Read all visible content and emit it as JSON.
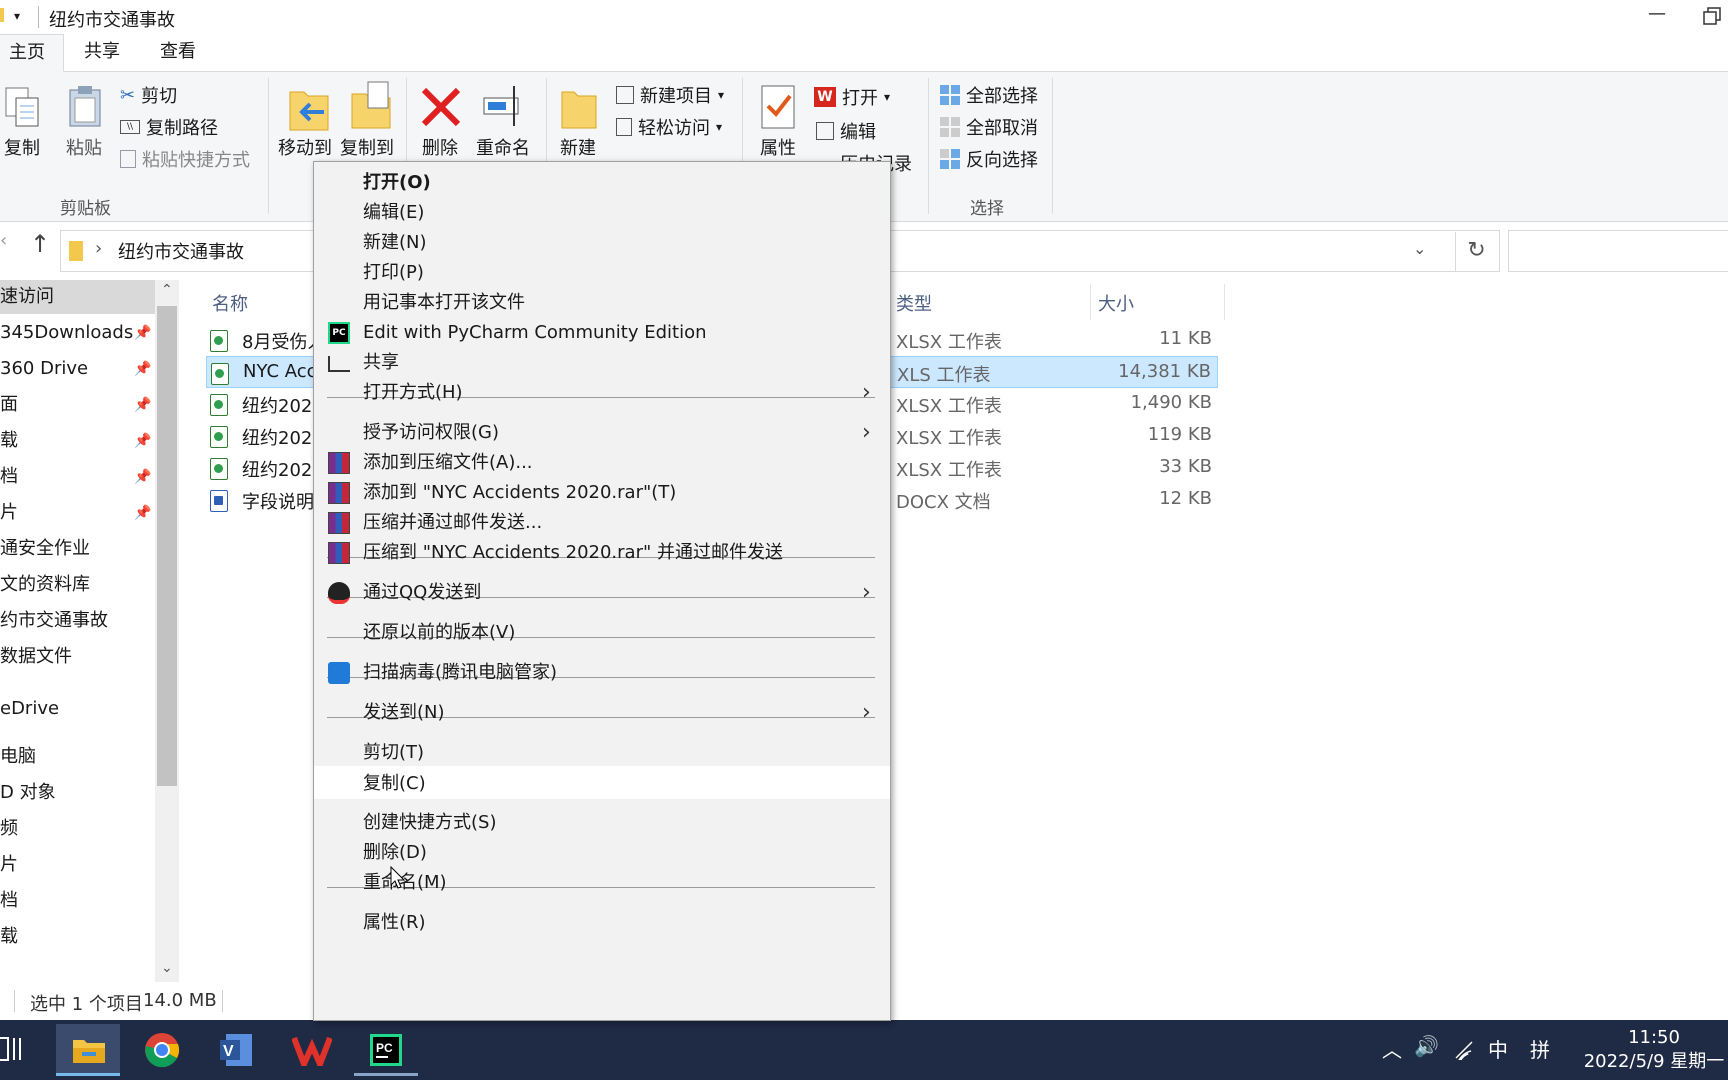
{
  "window": {
    "title": "纽约市交通事故"
  },
  "ribbon_tabs": [
    "主页",
    "共享",
    "查看"
  ],
  "ribbon": {
    "copy": "复制",
    "paste": "粘贴",
    "cut": "剪切",
    "copy_path": "复制路径",
    "paste_shortcut": "粘贴快捷方式",
    "clipboard_group": "剪贴板",
    "move_to": "移动到",
    "copy_to": "复制到",
    "delete": "删除",
    "rename": "重命名",
    "new_folder": "新建",
    "new_item": "新建项目",
    "easy_access": "轻松访问",
    "properties": "属性",
    "open": "打开",
    "edit": "编辑",
    "history_partial": "历史记录",
    "select_all": "全部选择",
    "select_none": "全部取消",
    "invert_selection": "反向选择",
    "select_group": "选择"
  },
  "address": {
    "path": "纽约市交通事故"
  },
  "nav": {
    "items": [
      {
        "label": "速访问",
        "pinned": false,
        "selected": true
      },
      {
        "label": "345Downloads",
        "pinned": true
      },
      {
        "label": "360 Drive",
        "pinned": true
      },
      {
        "label": "面",
        "pinned": true
      },
      {
        "label": "载",
        "pinned": true
      },
      {
        "label": "档",
        "pinned": true
      },
      {
        "label": "片",
        "pinned": true
      },
      {
        "label": "通安全作业",
        "pinned": false
      },
      {
        "label": "文的资料库",
        "pinned": false
      },
      {
        "label": "约市交通事故",
        "pinned": false
      },
      {
        "label": "数据文件",
        "pinned": false
      },
      {
        "label": "eDrive",
        "pinned": false
      },
      {
        "label": "电脑",
        "pinned": false
      },
      {
        "label": "D 对象",
        "pinned": false
      },
      {
        "label": "频",
        "pinned": false
      },
      {
        "label": "片",
        "pinned": false
      },
      {
        "label": "档",
        "pinned": false
      },
      {
        "label": "载",
        "pinned": false
      }
    ]
  },
  "columns": {
    "name": "名称",
    "type": "类型",
    "size": "大小"
  },
  "files": [
    {
      "name": "8月受伤人",
      "type": "XLSX 工作表",
      "size": "11 KB",
      "icon": "excel-icon",
      "selected": false
    },
    {
      "name": "NYC Acc",
      "type": "XLS 工作表",
      "size": "14,381 KB",
      "icon": "excel-icon",
      "selected": true
    },
    {
      "name": "纽约202",
      "type": "XLSX 工作表",
      "size": "1,490 KB",
      "icon": "excel-icon",
      "selected": false
    },
    {
      "name": "纽约202",
      "type": "XLSX 工作表",
      "size": "119 KB",
      "icon": "excel-icon",
      "selected": false
    },
    {
      "name": "纽约202",
      "type": "XLSX 工作表",
      "size": "33 KB",
      "icon": "excel-icon",
      "selected": false
    },
    {
      "name": "字段说明",
      "type": "DOCX 文档",
      "size": "12 KB",
      "icon": "word-icon",
      "selected": false
    }
  ],
  "status": {
    "selection": "选中 1 个项目",
    "size": "14.0 MB"
  },
  "context_menu": {
    "items": [
      {
        "label": "打开(O)",
        "bold": true
      },
      {
        "label": "编辑(E)"
      },
      {
        "label": "新建(N)"
      },
      {
        "label": "打印(P)"
      },
      {
        "label": "用记事本打开该文件"
      },
      {
        "label": "Edit with PyCharm Community Edition",
        "icon": "pycharm-icon"
      },
      {
        "label": "共享",
        "icon": "share-icon"
      },
      {
        "label": "打开方式(H)",
        "submenu": true
      },
      {
        "label": "授予访问权限(G)",
        "submenu": true
      },
      {
        "label": "添加到压缩文件(A)...",
        "icon": "winrar-icon"
      },
      {
        "label": "添加到 \"NYC Accidents 2020.rar\"(T)",
        "icon": "winrar-icon"
      },
      {
        "label": "压缩并通过邮件发送...",
        "icon": "winrar-icon"
      },
      {
        "label": "压缩到 \"NYC Accidents 2020.rar\" 并通过邮件发送",
        "icon": "winrar-icon"
      },
      {
        "label": "通过QQ发送到",
        "icon": "qq-icon",
        "submenu": true
      },
      {
        "label": "还原以前的版本(V)"
      },
      {
        "label": "扫描病毒(腾讯电脑管家)",
        "icon": "shield-icon"
      },
      {
        "label": "发送到(N)",
        "submenu": true
      },
      {
        "label": "剪切(T)"
      },
      {
        "label": "复制(C)",
        "hover": true
      },
      {
        "label": "创建快捷方式(S)"
      },
      {
        "label": "删除(D)"
      },
      {
        "label": "重命名(M)"
      },
      {
        "label": "属性(R)"
      }
    ]
  },
  "taskbar": {
    "clock_time": "11:50",
    "clock_date": "2022/5/9 星期一",
    "ime_lang": "中",
    "ime_mode": "拼"
  },
  "colors": {
    "accent": "#cce8ff",
    "taskbar": "#1f2a44",
    "menu_bg": "#f2f2f2"
  }
}
